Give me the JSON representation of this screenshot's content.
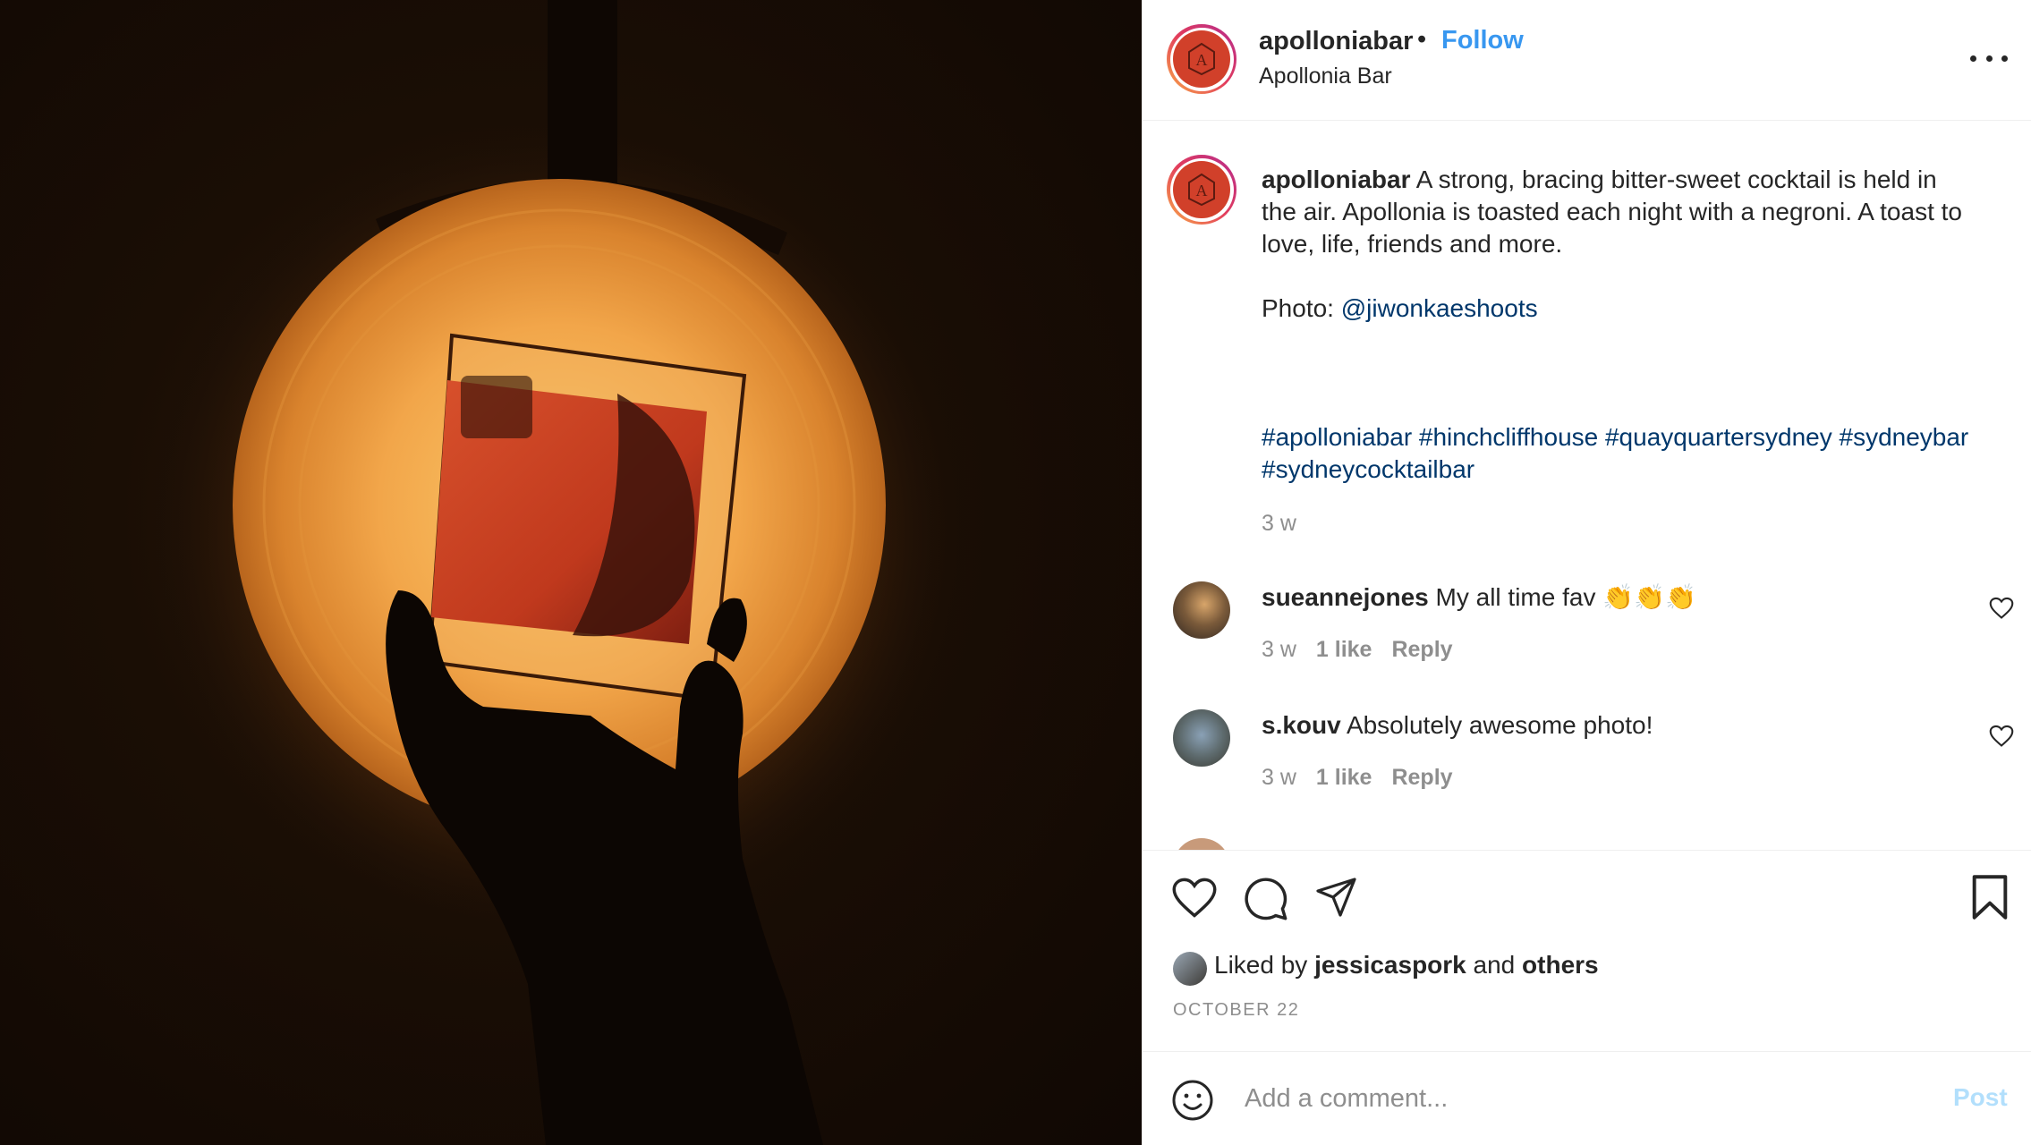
{
  "post": {
    "username": "apolloniabar",
    "follow_label": "Follow",
    "location": "Apollonia Bar",
    "more_icon": "more-horizontal-icon",
    "avatar_letter": "A"
  },
  "caption": {
    "username": "apolloniabar",
    "text_line1": "A strong, bracing bitter-sweet cocktail is held in",
    "text_line2": "the air. Apollonia is toasted each night with a negroni. A toast to",
    "text_line3": "love, life, friends and more.",
    "photo_prefix": "Photo: ",
    "photo_credit": "@jiwonkaeshoots",
    "hashtags_line1": "#apolloniabar #hinchcliffhouse #quayquartersydney #sydneybar",
    "hashtags_line2": "#sydneycocktailbar",
    "age": "3 w"
  },
  "comments": [
    {
      "username": "sueannejones",
      "text": "My all time fav",
      "emoji": "👏👏👏",
      "age": "3 w",
      "likes": "1 like",
      "reply_label": "Reply"
    },
    {
      "username": "s.kouv",
      "text": "Absolutely awesome photo!",
      "age": "3 w",
      "likes": "1 like",
      "reply_label": "Reply"
    }
  ],
  "actions": {
    "icons": [
      "heart-icon",
      "comment-icon",
      "share-icon",
      "bookmark-icon"
    ]
  },
  "likes": {
    "prefix": "Liked by ",
    "user": "jessicaspork",
    "and": " and ",
    "others": "others"
  },
  "date": "OCTOBER 22",
  "add_comment": {
    "placeholder": "Add a comment...",
    "post_label": "Post",
    "emoji_icon": "smiley-icon"
  }
}
